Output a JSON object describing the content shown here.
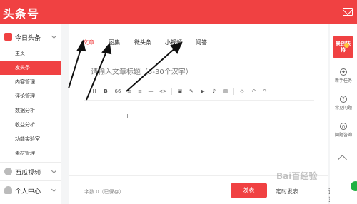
{
  "header": {
    "logo": "头条号"
  },
  "sidebar": {
    "group_toutiao": "今日头条",
    "items": [
      {
        "label": "主页",
        "active": false
      },
      {
        "label": "发头条",
        "active": true
      },
      {
        "label": "内容管理",
        "active": false
      },
      {
        "label": "评论管理",
        "active": false
      },
      {
        "label": "数据分析",
        "active": false
      },
      {
        "label": "收益分析",
        "active": false
      },
      {
        "label": "功能实验室",
        "active": false
      },
      {
        "label": "素材管理",
        "active": false
      }
    ],
    "group_xigua": "西瓜视频",
    "group_personal": "个人中心"
  },
  "tabs": [
    {
      "label": "文章",
      "active": true
    },
    {
      "label": "图集",
      "active": false
    },
    {
      "label": "微头条",
      "active": false
    },
    {
      "label": "小视频",
      "active": false
    },
    {
      "label": "问答",
      "active": false
    }
  ],
  "editor": {
    "title_placeholder": "请输入文章标题（5-30个汉字）",
    "toolbar": [
      "H",
      "B",
      "66",
      "≡",
      "≡",
      "—",
      "<>",
      "▣",
      "✎",
      "▶",
      "♪",
      "▥",
      "◇",
      "↶",
      "↷"
    ]
  },
  "footer": {
    "word_count": "字数 0（已保存）",
    "publish": "发表",
    "timed_publish": "定时发表",
    "preview": "预览"
  },
  "rightbar": {
    "promo": "景创扶持",
    "items": [
      "新手任务",
      "常见问题",
      "问题咨询"
    ]
  },
  "watermark": "Bai百经验",
  "colors": {
    "accent": "#f04142",
    "promo_dot": "#ffc93c",
    "notify_green": "#1fb141"
  }
}
